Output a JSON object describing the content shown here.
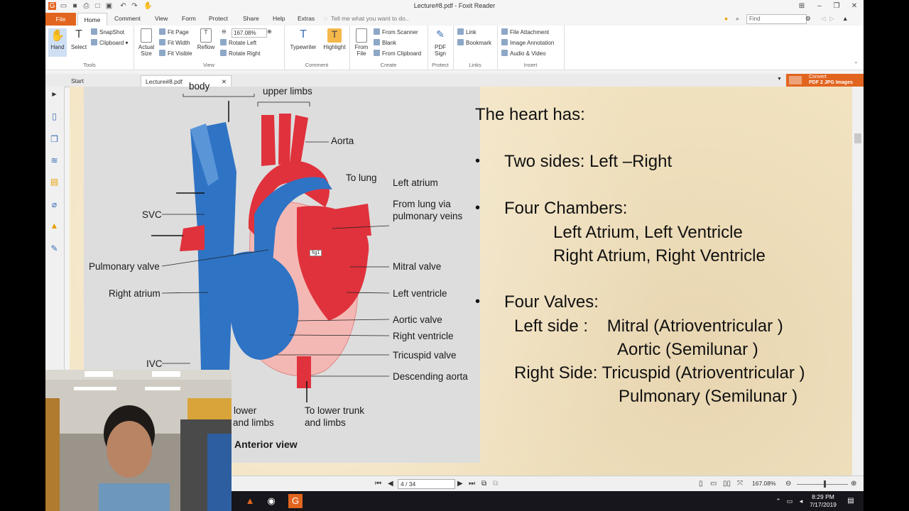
{
  "window": {
    "title": "Lecture#8.pdf - Foxit Reader"
  },
  "menu": {
    "file": "File",
    "tabs": [
      "Home",
      "Comment",
      "View",
      "Form",
      "Protect",
      "Share",
      "Help",
      "Extras"
    ],
    "tell_me": "Tell me what you want to do..",
    "find_placeholder": "Find"
  },
  "ribbon": {
    "tools": {
      "label": "Tools",
      "hand": "Hand",
      "select": "Select",
      "snapshot": "SnapShot",
      "clipboard": "Clipboard"
    },
    "view": {
      "label": "View",
      "actual_size": "Actual Size",
      "fit_page": "Fit Page",
      "fit_width": "Fit Width",
      "fit_visible": "Fit Visible",
      "reflow": "Reflow",
      "zoom": "167.08%",
      "rotate_left": "Rotate Left",
      "rotate_right": "Rotate Right"
    },
    "comment": {
      "label": "Comment",
      "typewriter": "Typewriter",
      "highlight": "Highlight"
    },
    "create": {
      "label": "Create",
      "from_file": "From File",
      "from_scanner": "From Scanner",
      "blank": "Blank",
      "from_clipboard": "From Clipboard"
    },
    "protect": {
      "label": "Protect",
      "pdf_sign": "PDF Sign"
    },
    "links": {
      "label": "Links",
      "link": "Link",
      "bookmark": "Bookmark"
    },
    "insert": {
      "label": "Insert",
      "file_attachment": "File Attachment",
      "image_annotation": "Image Annotation",
      "audio_video": "Audio & Video"
    }
  },
  "doc_tabs": {
    "start": "Start",
    "current": "Lecture#8.pdf",
    "convert_line1": "Convert",
    "convert_line2": "PDF 2 JPG Images"
  },
  "diagram": {
    "labels": {
      "body": "body",
      "upper_limbs": "upper limbs",
      "aorta": "Aorta",
      "to_lung": "To lung",
      "left_atrium": "Left atrium",
      "from_lung_1": "From lung via",
      "from_lung_2": "pulmonary veins",
      "svc": "SVC",
      "pulmonary_valve": "Pulmonary valve",
      "mitral_valve": "Mitral valve",
      "right_atrium": "Right atrium",
      "left_ventricle": "Left ventricle",
      "aortic_valve": "Aortic valve",
      "right_ventricle": "Right ventricle",
      "tricuspid_valve": "Tricuspid valve",
      "ivc": "IVC",
      "descending_aorta": "Descending aorta",
      "lower_1": "lower",
      "lower_2": "and limbs",
      "to_lower_1": "To lower trunk",
      "to_lower_2": "and limbs",
      "anterior_view": "Anterior view"
    },
    "tooltip": "fig1"
  },
  "slide": {
    "heading": "The heart has:",
    "line1": "Two sides: Left –Right",
    "line2": "Four Chambers:",
    "line3": "Left Atrium,  Left Ventricle",
    "line4": "Right Atrium,  Right Ventricle",
    "line5": "Four Valves:",
    "line6": "Left side :    Mitral (Atrioventricular )",
    "line7": "Aortic (Semilunar )",
    "line8": "Right Side: Tricuspid (Atrioventricular )",
    "line9": "Pulmonary (Semilunar )"
  },
  "status": {
    "page": "4 / 34",
    "zoom": "167.08%"
  },
  "taskbar": {
    "time": "8:29 PM",
    "date": "7/17/2019"
  },
  "colors": {
    "accent": "#e2651f",
    "artery": "#e0323c",
    "vein": "#2f73c4"
  }
}
